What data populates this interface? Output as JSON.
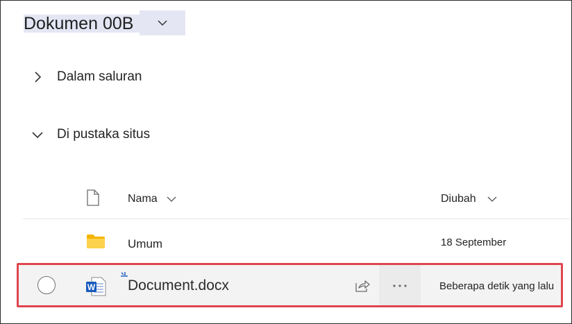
{
  "header": {
    "title": "Dokumen 00B",
    "dropdown_icon": "chevron-down-icon"
  },
  "sections": [
    {
      "label": "Dalam saluran",
      "state": "collapsed",
      "icon": "chevron-right-icon"
    },
    {
      "label": "Di pustaka situs",
      "state": "expanded",
      "icon": "chevron-down-icon"
    }
  ],
  "table": {
    "header_icon": "file-type-icon",
    "columns": [
      {
        "label": "Nama",
        "sort_icon": "chevron-down-icon"
      },
      {
        "label": "Diubah",
        "sort_icon": "chevron-down-icon"
      }
    ],
    "rows": [
      {
        "icon": "folder-icon",
        "name": "Umum",
        "modified": "18 September"
      },
      {
        "icon": "word-document-icon",
        "name": "Document.docx",
        "modified": "Beberapa detik yang lalu",
        "new_indicator": "new-item-sparkle-icon",
        "highlighted": true
      }
    ]
  },
  "row_actions": {
    "share_icon": "share-icon",
    "more_icon": "more-options-icon"
  },
  "colors": {
    "title_highlight": "#e4e6f4",
    "folder": "#f7c948",
    "word_blue": "#185abd",
    "highlight_border": "#e0454e",
    "row_hover": "#f3f3f3"
  }
}
